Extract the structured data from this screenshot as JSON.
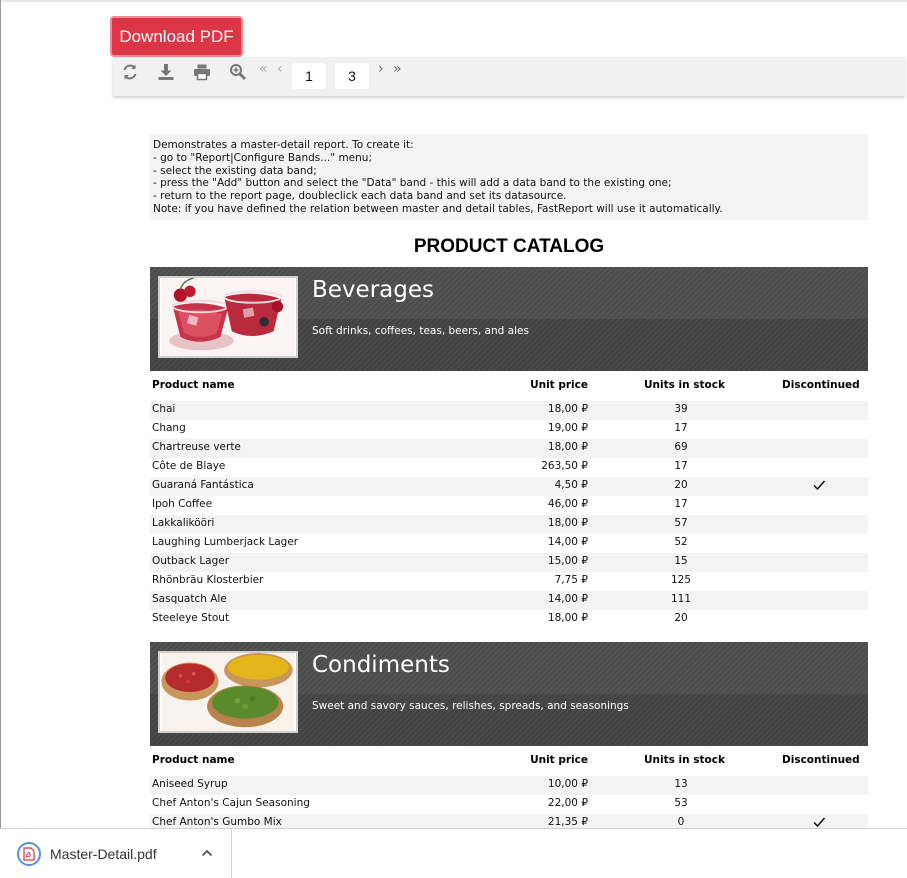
{
  "toolbar": {
    "download_pdf_label": "Download PDF",
    "icons": [
      "refresh-icon",
      "download-icon",
      "print-icon",
      "zoom-icon"
    ],
    "first_glyph": "«",
    "prev_glyph": "‹",
    "next_glyph": "›",
    "last_glyph": "»",
    "current_page": "1",
    "total_pages": "3"
  },
  "report": {
    "description": [
      "Demonstrates a master-detail report. To create it:",
      "- go to \"Report|Configure Bands...\" menu;",
      "- select the existing data band;",
      "- press the \"Add\" button and select the \"Data\" band - this will add a data band to the existing one;",
      "- return to the report page, doubleclick each data band and set its datasource.",
      "Note: if you have defined the relation between master and detail tables, FastReport will use it automatically."
    ],
    "title": "PRODUCT CATALOG",
    "columns": {
      "name": "Product name",
      "price": "Unit price",
      "stock": "Units in stock",
      "discontinued": "Discontinued"
    },
    "categories": [
      {
        "name": "Beverages",
        "description": "Soft drinks, coffees, teas, beers, and ales",
        "products": [
          {
            "name": "Chai",
            "price": "18,00 ₽",
            "stock": "39",
            "discontinued": false
          },
          {
            "name": "Chang",
            "price": "19,00 ₽",
            "stock": "17",
            "discontinued": false
          },
          {
            "name": "Chartreuse verte",
            "price": "18,00 ₽",
            "stock": "69",
            "discontinued": false
          },
          {
            "name": "Côte de Blaye",
            "price": "263,50 ₽",
            "stock": "17",
            "discontinued": false
          },
          {
            "name": "Guaraná Fantástica",
            "price": "4,50 ₽",
            "stock": "20",
            "discontinued": true
          },
          {
            "name": "Ipoh Coffee",
            "price": "46,00 ₽",
            "stock": "17",
            "discontinued": false
          },
          {
            "name": "Lakkalikööri",
            "price": "18,00 ₽",
            "stock": "57",
            "discontinued": false
          },
          {
            "name": "Laughing Lumberjack Lager",
            "price": "14,00 ₽",
            "stock": "52",
            "discontinued": false
          },
          {
            "name": "Outback Lager",
            "price": "15,00 ₽",
            "stock": "15",
            "discontinued": false
          },
          {
            "name": "Rhönbräu Klosterbier",
            "price": "7,75 ₽",
            "stock": "125",
            "discontinued": false
          },
          {
            "name": "Sasquatch Ale",
            "price": "14,00 ₽",
            "stock": "111",
            "discontinued": false
          },
          {
            "name": "Steeleye Stout",
            "price": "18,00 ₽",
            "stock": "20",
            "discontinued": false
          }
        ]
      },
      {
        "name": "Condiments",
        "description": "Sweet and savory sauces, relishes, spreads, and seasonings",
        "products": [
          {
            "name": "Aniseed Syrup",
            "price": "10,00 ₽",
            "stock": "13",
            "discontinued": false
          },
          {
            "name": "Chef Anton's Cajun Seasoning",
            "price": "22,00 ₽",
            "stock": "53",
            "discontinued": false
          },
          {
            "name": "Chef Anton's Gumbo Mix",
            "price": "21,35 ₽",
            "stock": "0",
            "discontinued": true
          }
        ]
      }
    ]
  },
  "downloads": {
    "file_name": "Master-Detail.pdf",
    "file_icon": "pdf-file-icon",
    "menu_icon": "chevron-up-icon"
  },
  "colors": {
    "download_button": "#dc3545",
    "category_band": "#4d4d4d",
    "row_alt": "#f3f3f3"
  }
}
